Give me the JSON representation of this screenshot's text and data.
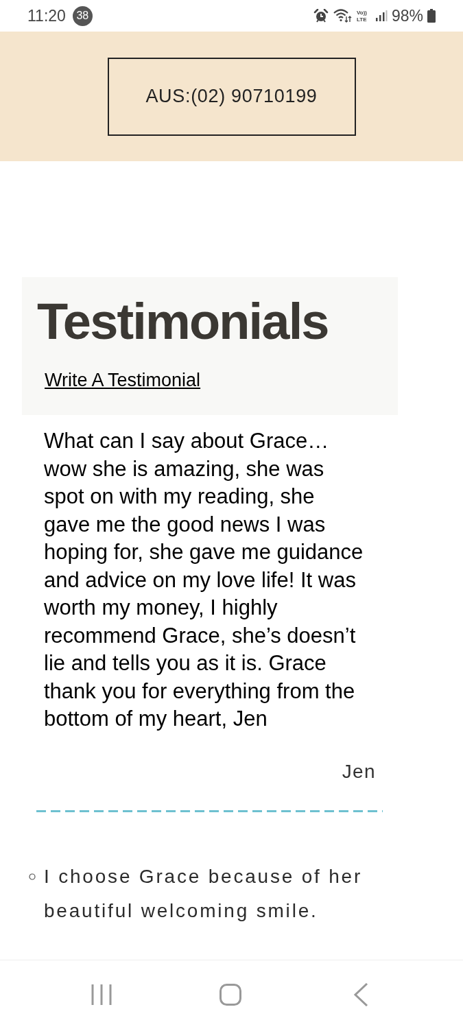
{
  "status_bar": {
    "time": "11:20",
    "notification_count": "38",
    "volte_top": "Vo))",
    "volte_bottom": "LTE",
    "battery": "98%"
  },
  "contact": {
    "phone": "AUS:(02) 90710199"
  },
  "testimonials": {
    "title": "Testimonials",
    "write_link": "Write A Testimonial"
  },
  "testimonial": {
    "text": "What can I say about Grace… wow she is amazing, she was spot on with my reading, she gave me the good news I was hoping for, she gave me guidance and advice on my love life! It was worth my money, I highly recommend Grace, she’s doesn’t lie and tells you as it is. Grace thank you for everything from the bottom of my heart, Jen",
    "author": "Jen"
  },
  "list_items": [
    "I choose Grace because of her beautiful welcoming smile."
  ]
}
